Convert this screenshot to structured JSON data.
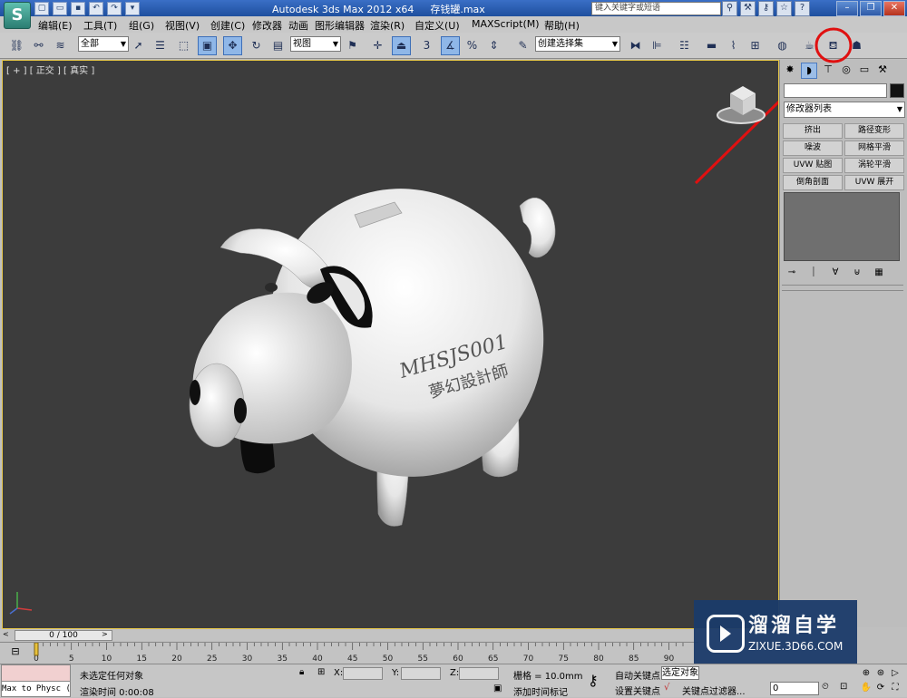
{
  "app": {
    "title": "Autodesk 3ds Max  2012 x64",
    "file": "存钱罐.max",
    "logo": "S",
    "search_placeholder": "键入关键字或短语"
  },
  "quick_access": [
    "new-icon",
    "open-icon",
    "save-icon",
    "undo-icon",
    "redo-icon",
    "dropdown-icon"
  ],
  "title_icons": [
    "binoculars-icon",
    "wrench-icon",
    "key-icon",
    "star-icon",
    "help-icon"
  ],
  "window_buttons": [
    "minimize",
    "restore",
    "close"
  ],
  "menu": [
    {
      "label": "编辑(E)"
    },
    {
      "label": "工具(T)"
    },
    {
      "label": "组(G)"
    },
    {
      "label": "视图(V)"
    },
    {
      "label": "创建(C)"
    },
    {
      "label": "修改器"
    },
    {
      "label": "动画"
    },
    {
      "label": "图形编辑器"
    },
    {
      "label": "渲染(R)"
    },
    {
      "label": "自定义(U)"
    },
    {
      "label": "MAXScript(M)"
    },
    {
      "label": "帮助(H)"
    }
  ],
  "toolbar": {
    "selection_filter": "全部",
    "ref_coord": "视图",
    "snap_value": "3",
    "named_selection": "创建选择集"
  },
  "viewport": {
    "label": "[ + ] [ 正交 ] [ 真实 ]",
    "model_text_line1": "MHSJS001",
    "model_text_line2": "夢幻設計師"
  },
  "command_panel": {
    "modifier_list": "修改器列表",
    "buttons": [
      "挤出",
      "路径变形",
      "噪波",
      "网格平滑",
      "UVW 贴图",
      "涡轮平滑",
      "倒角剖面",
      "UVW 展开"
    ]
  },
  "time_slider": {
    "label": "0 / 100"
  },
  "track_bar": {
    "ticks": [
      "0",
      "5",
      "10",
      "15",
      "20",
      "25",
      "30",
      "35",
      "40",
      "45",
      "50",
      "55",
      "60",
      "65",
      "70",
      "75",
      "80",
      "85",
      "90"
    ]
  },
  "status_bar": {
    "maxscript": "Max to Physc (",
    "selection_status": "未选定任何对象",
    "render_time": "渲染时间  0:00:08",
    "x_label": "X:",
    "y_label": "Y:",
    "z_label": "Z:",
    "grid": "栅格 = 10.0mm",
    "add_time_tag": "添加时间标记",
    "auto_key": "自动关键点",
    "set_key": "设置关键点",
    "selected_objects": "选定对象",
    "key_filters": "关键点过滤器...",
    "frame": "0"
  },
  "watermark": {
    "title": "溜溜自学",
    "url": "ZIXUE.3D66.COM"
  },
  "colors": {
    "viewport_bg": "#3c3c3c",
    "viewport_border": "#e7c84a",
    "annotation_red": "#e01010",
    "watermark_bg": "#1b3b6a"
  }
}
